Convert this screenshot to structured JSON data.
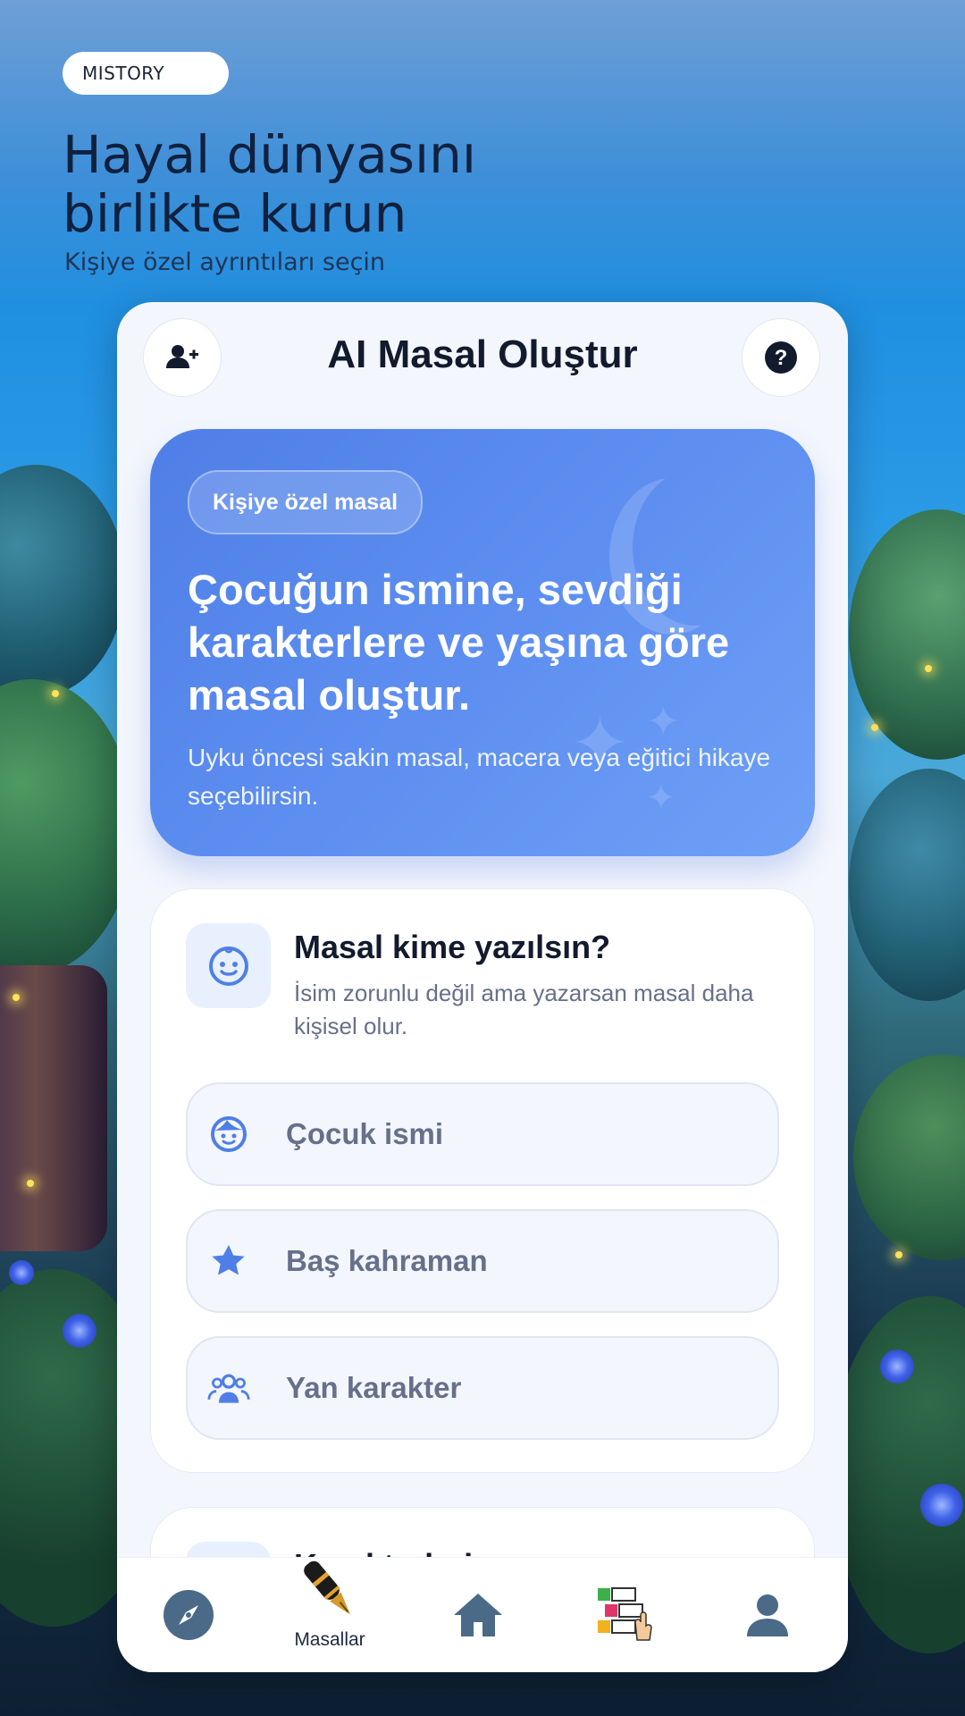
{
  "app": {
    "brand": "MISTORY"
  },
  "hero": {
    "title_line1": "Hayal dünyasını",
    "title_line2": "birlikte kurun",
    "subtitle": "Kişiye özel ayrıntıları seçin"
  },
  "card": {
    "title": "AI Masal Oluştur",
    "left_icon": "add-user-icon",
    "right_icon": "help-icon"
  },
  "banner": {
    "pill": "Kişiye özel masal",
    "headline": "Çocuğun ismine, sevdiği karakterlere ve yaşına göre masal oluştur.",
    "description": "Uyku öncesi sakin masal, macera veya eğitici hikaye seçebilirsin."
  },
  "form": {
    "title": "Masal kime yazılsın?",
    "subtitle": "İsim zorunlu değil ama yazarsan masal daha kişisel olur.",
    "fields": [
      {
        "placeholder": "Çocuk ismi",
        "icon": "child-face-icon"
      },
      {
        "placeholder": "Baş kahraman",
        "icon": "star-icon"
      },
      {
        "placeholder": "Yan karakter",
        "icon": "group-icon"
      }
    ]
  },
  "next_section": {
    "title": "Karakterleri"
  },
  "nav": {
    "items": [
      {
        "icon": "compass-icon",
        "label": ""
      },
      {
        "icon": "fountain-pen-icon",
        "label": "Masallar"
      },
      {
        "icon": "home-icon",
        "label": ""
      },
      {
        "icon": "numbered-list-icon",
        "label": ""
      },
      {
        "icon": "profile-icon",
        "label": ""
      }
    ]
  },
  "colors": {
    "accent": "#4f7fe6",
    "title_text": "#121a2d",
    "nav_icon": "#4a6a88"
  }
}
